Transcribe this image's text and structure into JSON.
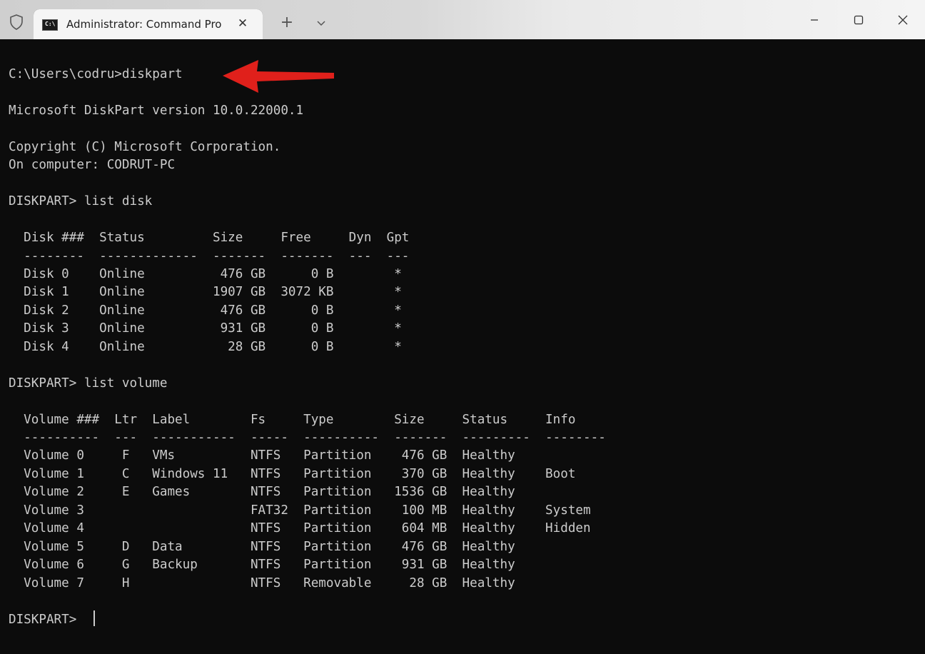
{
  "titlebar": {
    "tab_title": "Administrator: Command Pro",
    "tab_icon_text": "C:\\",
    "close_tab_label": "✕",
    "new_tab_label": "+"
  },
  "terminal": {
    "lines": [
      "C:\\Users\\codru>diskpart",
      "",
      "Microsoft DiskPart version 10.0.22000.1",
      "",
      "Copyright (C) Microsoft Corporation.",
      "On computer: CODRUT-PC",
      "",
      "DISKPART> list disk",
      "",
      "  Disk ###  Status         Size     Free     Dyn  Gpt",
      "  --------  -------------  -------  -------  ---  ---",
      "  Disk 0    Online          476 GB      0 B        *",
      "  Disk 1    Online         1907 GB  3072 KB        *",
      "  Disk 2    Online          476 GB      0 B        *",
      "  Disk 3    Online          931 GB      0 B        *",
      "  Disk 4    Online           28 GB      0 B        *",
      "",
      "DISKPART> list volume",
      "",
      "  Volume ###  Ltr  Label        Fs     Type        Size     Status     Info",
      "  ----------  ---  -----------  -----  ----------  -------  ---------  --------",
      "  Volume 0     F   VMs          NTFS   Partition    476 GB  Healthy",
      "  Volume 1     C   Windows 11   NTFS   Partition    370 GB  Healthy    Boot",
      "  Volume 2     E   Games        NTFS   Partition   1536 GB  Healthy",
      "  Volume 3                      FAT32  Partition    100 MB  Healthy    System",
      "  Volume 4                      NTFS   Partition    604 MB  Healthy    Hidden",
      "  Volume 5     D   Data         NTFS   Partition    476 GB  Healthy",
      "  Volume 6     G   Backup       NTFS   Partition    931 GB  Healthy",
      "  Volume 7     H                NTFS   Removable     28 GB  Healthy",
      "",
      "DISKPART> "
    ]
  },
  "colors": {
    "terminal_bg": "#0c0c0c",
    "terminal_fg": "#cccccc",
    "annotation_arrow": "#e0201b"
  },
  "icons": {
    "shield": "shield-icon",
    "tab_icon": "terminal-icon",
    "close_tab": "close-icon",
    "new_tab": "plus-icon",
    "dropdown": "chevron-down-icon",
    "minimize": "minimize-icon",
    "maximize": "maximize-icon",
    "close_window": "close-icon",
    "annotation": "arrow-icon"
  }
}
